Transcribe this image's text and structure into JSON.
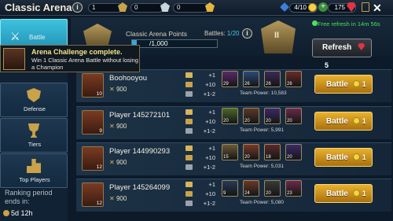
{
  "header": {
    "title": "Classic Arena",
    "silver_medals": "1",
    "gold_medals": "0",
    "platinum_medals": "0",
    "energy": "4/10",
    "gems": "175"
  },
  "nav": {
    "items": [
      {
        "label": "Battle",
        "active": true
      },
      {
        "label": "Defense"
      },
      {
        "label": "Tiers"
      },
      {
        "label": "Top Players"
      }
    ],
    "ranking_label": "Ranking period ends in:",
    "ranking_timer": "5d 12h"
  },
  "arena": {
    "points_label": "Classic Arena Points",
    "points_value": "/1,000",
    "battles_label": "Battles:",
    "battles_value": "1/20",
    "free_refresh": "Free refresh in 14m 56s",
    "refresh_label": "Refresh",
    "refresh_cost": "5"
  },
  "tooltip": {
    "title": "Arena Challenge complete.",
    "text": "Win 1 Classic Arena Battle without losing a Champion"
  },
  "opponents": [
    {
      "name": "Boohooyou",
      "level": "10",
      "power": "900",
      "rewards": [
        "+1",
        "+10",
        "+1-2"
      ],
      "team_power": "Team Power: 10,583",
      "hero_levels": [
        "29",
        "26",
        "26",
        "26"
      ],
      "battle_label": "Battle",
      "battle_cost": "1"
    },
    {
      "name": "Player 145272101",
      "level": "9",
      "power": "900",
      "rewards": [
        "+1",
        "+10",
        "+1-2"
      ],
      "team_power": "Team Power: 5,991",
      "hero_levels": [
        "20",
        "20",
        "20",
        "20"
      ],
      "battle_label": "Battle",
      "battle_cost": "1"
    },
    {
      "name": "Player 144990293",
      "level": "12",
      "power": "900",
      "rewards": [
        "+1",
        "+10",
        "+1-2"
      ],
      "team_power": "Team Power: 5,031",
      "hero_levels": [
        "15",
        "20",
        "18",
        "20"
      ],
      "battle_label": "Battle",
      "battle_cost": "1"
    },
    {
      "name": "Player 145264099",
      "level": "12",
      "power": "900",
      "rewards": [
        "+1",
        "+10",
        "+1-2"
      ],
      "team_power": "Team Power: 5,080",
      "hero_levels": [
        "9",
        "24",
        "20",
        "23"
      ],
      "battle_label": "Battle",
      "battle_cost": "1"
    }
  ]
}
